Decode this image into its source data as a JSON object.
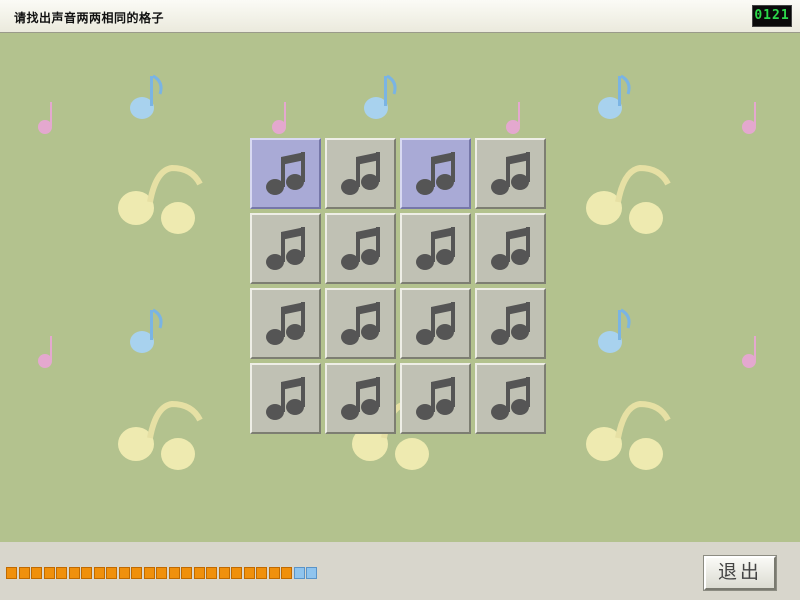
{
  "window": {
    "title": "请找出声音两两相同的格子",
    "timer": "0121"
  },
  "board": {
    "rows": 4,
    "cols": 4,
    "selected_cells": [
      0,
      2
    ],
    "cell_icon": "music-note-icon"
  },
  "progress": {
    "total_segments": 25,
    "elapsed_fraction": 0.92
  },
  "controls": {
    "exit_label": "退出"
  },
  "colors": {
    "background": "#b3c28e",
    "cell": "#c0c1b4",
    "cell_selected": "#a9aad6",
    "progress_remaining": "#f0900c",
    "progress_elapsed": "#8fc4ee",
    "timer_text": "#2bd84a"
  }
}
